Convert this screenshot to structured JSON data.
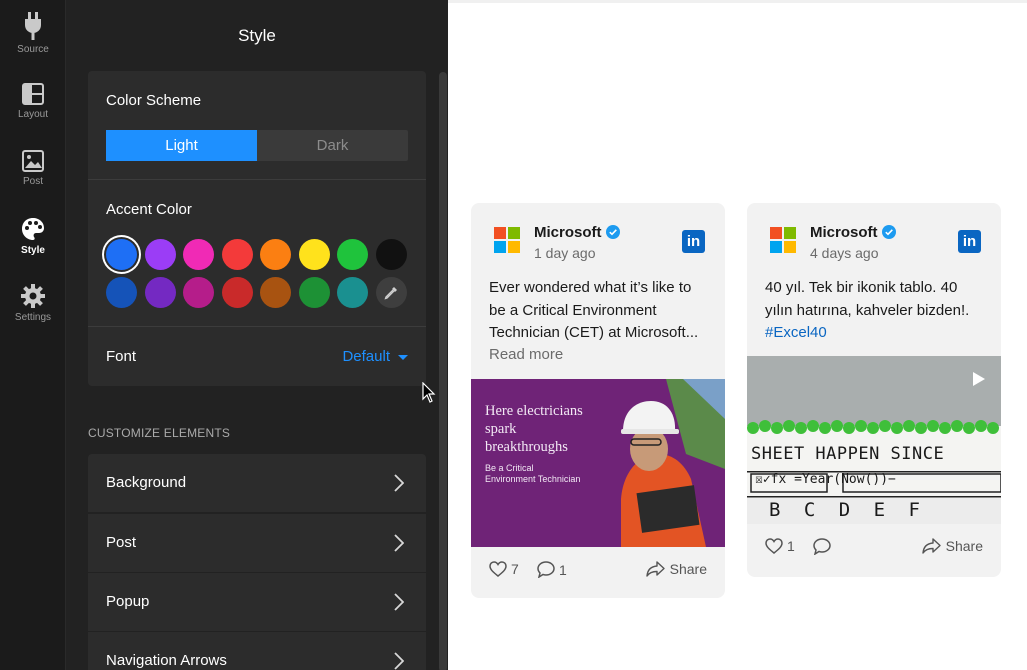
{
  "rail": {
    "items": [
      {
        "label": "Source",
        "icon": "plug-icon"
      },
      {
        "label": "Layout",
        "icon": "layout-icon"
      },
      {
        "label": "Post",
        "icon": "image-icon"
      },
      {
        "label": "Style",
        "icon": "palette-icon",
        "active": true
      },
      {
        "label": "Settings",
        "icon": "gear-icon"
      }
    ]
  },
  "panel": {
    "title": "Style",
    "color_scheme": {
      "label": "Color Scheme",
      "options": [
        "Light",
        "Dark"
      ],
      "selected": "Light"
    },
    "accent_color": {
      "label": "Accent Color",
      "swatches_row1": [
        "#1e6ff5",
        "#9b3df6",
        "#f02ab5",
        "#f33a3a",
        "#fb7f12",
        "#ffe21c",
        "#1fc33c",
        "#111111"
      ],
      "swatches_row2": [
        "#1553b8",
        "#7429c2",
        "#b51d8a",
        "#c92a2a",
        "#a85311",
        "#1d9135",
        "#1a9090"
      ],
      "selected": "#1e6ff5",
      "picker_icon": "eyedropper-icon"
    },
    "font": {
      "label": "Font",
      "value": "Default"
    },
    "customize_heading": "CUSTOMIZE ELEMENTS",
    "elements": [
      "Background",
      "Post",
      "Popup",
      "Navigation Arrows"
    ]
  },
  "colors": {
    "accent": "#1e90ff",
    "panel_bg": "#222222",
    "card_bg": "#2c2c2c",
    "linkedin": "#0a66c2"
  },
  "posts": [
    {
      "author": "Microsoft",
      "time": "1 day ago",
      "text": "Ever wondered what it’s like to be a Critical Environment Technician (CET) at Microsoft...",
      "read_more": "Read more",
      "image": {
        "headline_lines": [
          "Here electricians",
          "spark",
          "breakthroughs"
        ],
        "sub_lines": [
          "Be a Critical",
          "Environment Technician"
        ]
      },
      "likes": "7",
      "comments": "1",
      "share": "Share"
    },
    {
      "author": "Microsoft",
      "time": "4 days ago",
      "text": "40 yıl. Tek bir ikonik tablo. 40 yılın hatırına, kahveler bizden!.",
      "hashtag": "#Excel40",
      "image": {
        "cake_line1": "SHEET HAPPEN SINCE",
        "cake_line2": "☒✓fx  =Year(Now())−",
        "cake_cols": "B C D E F"
      },
      "likes": "1",
      "share": "Share"
    }
  ]
}
